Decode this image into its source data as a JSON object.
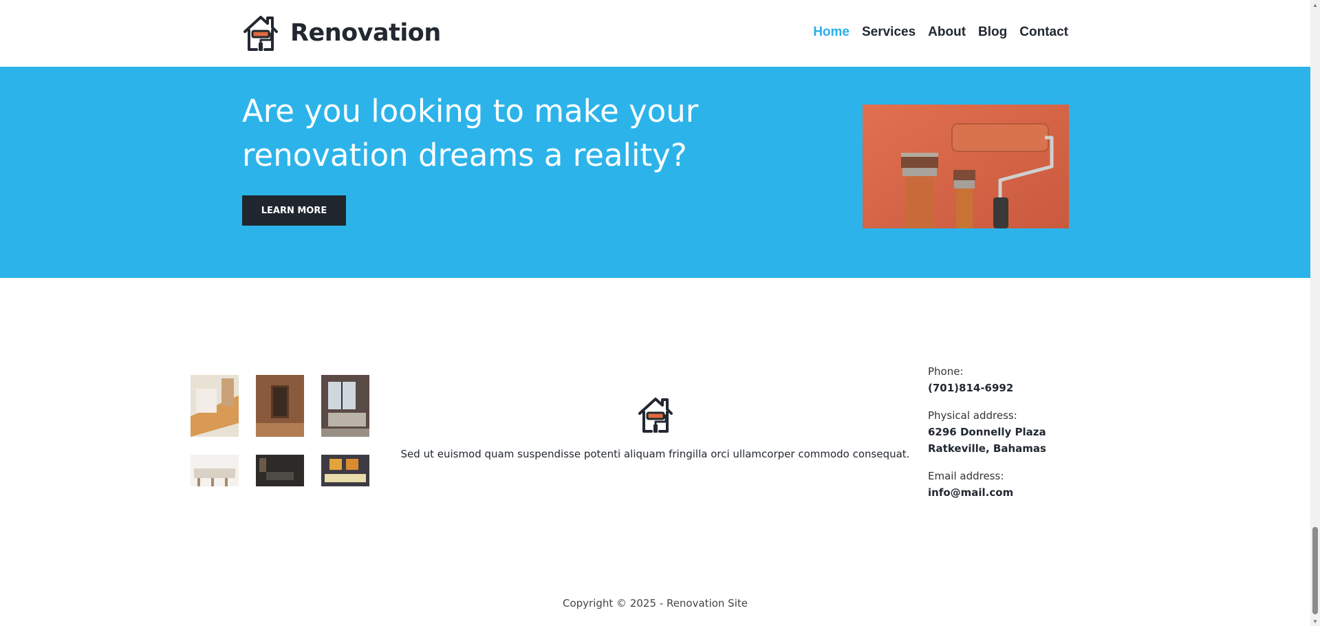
{
  "header": {
    "brand_name": "Renovation",
    "nav": [
      {
        "label": "Home",
        "active": true
      },
      {
        "label": "Services",
        "active": false
      },
      {
        "label": "About",
        "active": false
      },
      {
        "label": "Blog",
        "active": false
      },
      {
        "label": "Contact",
        "active": false
      }
    ]
  },
  "hero": {
    "title": "Are you looking to make your renovation dreams a reality?",
    "button_label": "LEARN MORE",
    "image": "paint-brushes-and-roller-on-orange-wall"
  },
  "footer": {
    "gallery": [
      "carpentry-tools-photo",
      "brick-hallway-photo",
      "living-room-window-photo",
      "white-kitchen-photo",
      "dark-living-room-photo",
      "yellow-sofa-room-photo"
    ],
    "description": "Sed ut euismod quam suspendisse potenti aliquam fringilla orci ullamcorper commodo consequat.",
    "contact": {
      "phone_label": "Phone:",
      "phone": "(701)814-6992",
      "address_label": "Physical address:",
      "address": "6296 Donnelly Plaza Ratkeville, Bahamas",
      "email_label": "Email address:",
      "email": "info@mail.com"
    },
    "copyright": "Copyright © 2025 - Renovation Site"
  },
  "colors": {
    "accent": "#2cb4ea",
    "dark": "#20262e",
    "text": "#222831",
    "roller": "#e06a40"
  }
}
